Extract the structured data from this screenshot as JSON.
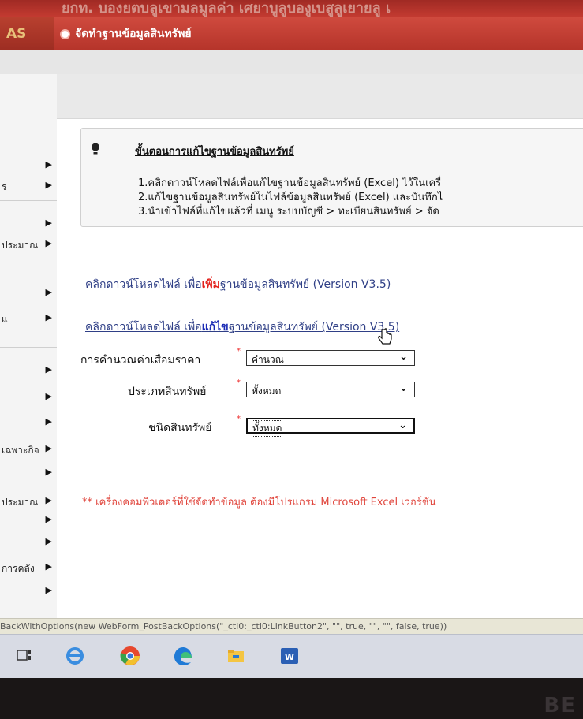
{
  "app": {
    "top_banner": "ยกท. บองยตบลูเขามลมูลค่า เศยาบูลูบองูเบสูลูเยายลู เ",
    "logo": "AS",
    "page_title": "จัดทำฐานข้อมูลสินทรัพย์"
  },
  "sidebar": {
    "items": [
      {
        "label": ""
      },
      {
        "label": "ร"
      },
      {
        "label": ""
      },
      {
        "label": "ประมาณ"
      },
      {
        "label": ""
      },
      {
        "label": "แ"
      },
      {
        "label": ""
      },
      {
        "label": ""
      },
      {
        "label": ""
      },
      {
        "label": "เฉพาะกิจ"
      },
      {
        "label": ""
      },
      {
        "label": "ประมาณ"
      },
      {
        "label": ""
      },
      {
        "label": ""
      },
      {
        "label": "การคลัง"
      },
      {
        "label": ""
      }
    ]
  },
  "info": {
    "heading": "ขั้นตอนการแก้ไขฐานข้อมูลสินทรัพย์",
    "steps": [
      "1.คลิกดาวน์โหลดไฟล์เพื่อแก้ไขฐานข้อมูลสินทรัพย์ (Excel) ไว้ในเครื่",
      "2.แก้ไขฐานข้อมูลสินทรัพย์ในไฟล์ข้อมูลสินทรัพย์ (Excel) และบันทึกไ",
      "3.นำเข้าไฟล์ที่แก้ไขแล้วที่ เมนู ระบบบัญชี > ทะเบียนสินทรัพย์ > จัด"
    ]
  },
  "links": {
    "add_prefix": "คลิกดาวน์โหลดไฟล์ เพื่อ",
    "add_keyword": "เพิ่ม",
    "add_suffix": "ฐานข้อมูลสินทรัพย์ (Version V3.5)",
    "edit_prefix": "คลิกดาวน์โหลดไฟล์ เพื่อ",
    "edit_keyword": "แก้ไข",
    "edit_suffix": "ฐานข้อมูลสินทรัพย์ (Version V3.5)"
  },
  "form": {
    "depreciation_label": "การคำนวณค่าเสื่อมราคา",
    "depreciation_value": "คำนวณ",
    "asset_type_label": "ประเภทสินทรัพย์",
    "asset_type_value": "ทั้งหมด",
    "asset_kind_label": "ชนิดสินทรัพย์",
    "asset_kind_value": "ทั้งหมด",
    "required_mark": "*"
  },
  "note": "** เครื่องคอมพิวเตอร์ที่ใช้จัดทำข้อมูล ต้องมีโปรแกรม Microsoft Excel เวอร์ชัน",
  "status_bar": "BackWithOptions(new WebForm_PostBackOptions(\"_ctl0:_ctl0:LinkButton2\", \"\", true, \"\", \"\", false, true))",
  "bezel_text": "BE",
  "colors": {
    "title_bar": "#c2392f",
    "link": "#2f3f86",
    "link_add_highlight": "#e3201b",
    "link_edit_highlight": "#1a2ab5",
    "note": "#e0453c",
    "required": "#ee3333"
  },
  "taskbar": {
    "icons": [
      "task-view-icon",
      "internet-explorer-icon",
      "chrome-icon",
      "edge-icon",
      "file-explorer-icon",
      "word-icon"
    ]
  }
}
